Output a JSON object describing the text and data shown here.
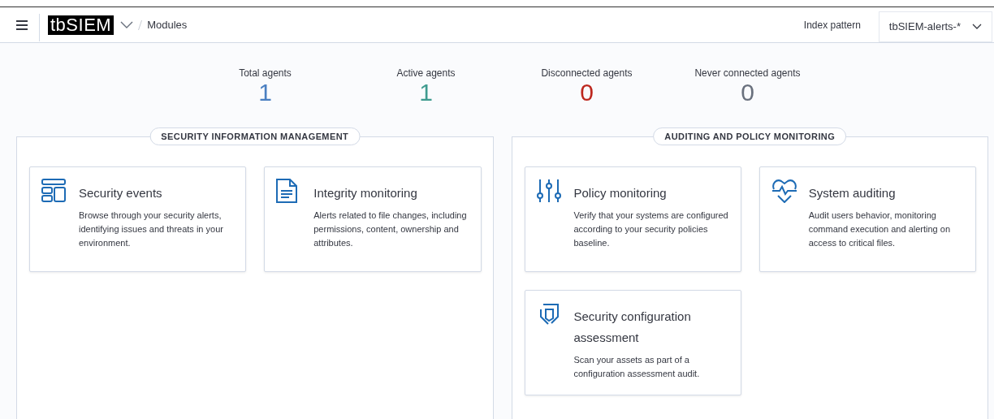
{
  "header": {
    "logo": "tbSIEM",
    "breadcrumb": "Modules",
    "index_pattern_label": "Index pattern",
    "index_pattern_value": "tbSIEM-alerts-*"
  },
  "stats": [
    {
      "label": "Total agents",
      "value": "1",
      "color": "#4a7fc1"
    },
    {
      "label": "Active agents",
      "value": "1",
      "color": "#3f9b8f"
    },
    {
      "label": "Disconnected agents",
      "value": "0",
      "color": "#bd271e"
    },
    {
      "label": "Never connected agents",
      "value": "0",
      "color": "#69707d"
    }
  ],
  "sections": [
    {
      "title": "SECURITY INFORMATION MANAGEMENT",
      "cards": [
        {
          "kind": "layout",
          "title": "Security events",
          "description": "Browse through your security alerts, identifying issues and threats in your environment."
        },
        {
          "kind": "document",
          "title": "Integrity monitoring",
          "description": "Alerts related to file changes, including permissions, content, ownership and attributes."
        }
      ]
    },
    {
      "title": "AUDITING AND POLICY MONITORING",
      "cards": [
        {
          "kind": "sliders",
          "title": "Policy monitoring",
          "description": "Verify that your systems are configured according to your security policies baseline."
        },
        {
          "kind": "heartbeat",
          "title": "System auditing",
          "description": "Audit users behavior, monitoring command execution and alerting on access to critical files."
        },
        {
          "kind": "shield",
          "title": "Security configuration assessment",
          "description": "Scan your assets as part of a configuration assessment audit."
        }
      ]
    }
  ]
}
